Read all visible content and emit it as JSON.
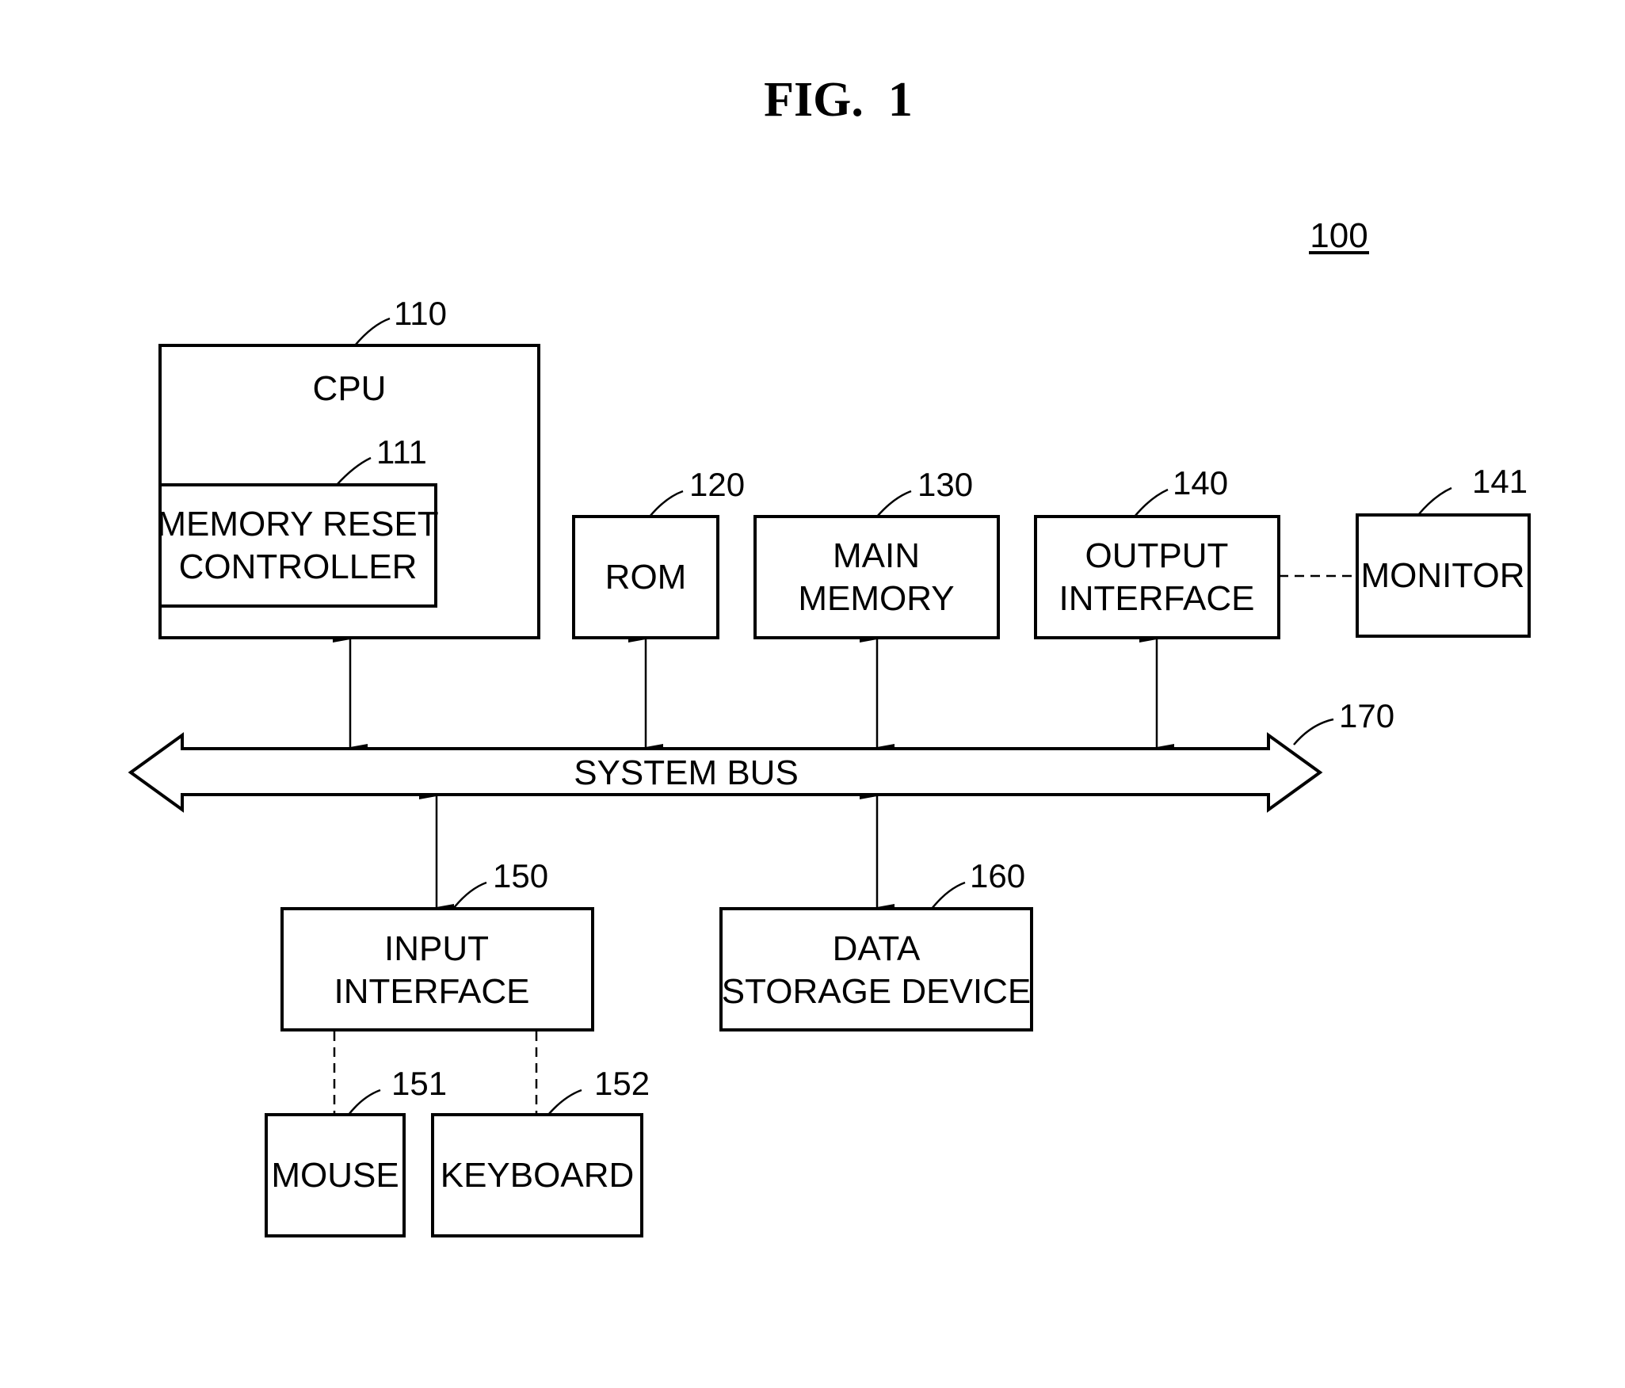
{
  "figure": {
    "title": "FIG.  1",
    "system_ref": "100"
  },
  "blocks": {
    "cpu": {
      "ref": "110",
      "lines": [
        "CPU"
      ]
    },
    "memory_reset_controller": {
      "ref": "111",
      "lines": [
        "MEMORY RESET",
        "CONTROLLER"
      ]
    },
    "rom": {
      "ref": "120",
      "lines": [
        "ROM"
      ]
    },
    "main_memory": {
      "ref": "130",
      "lines": [
        "MAIN",
        "MEMORY"
      ]
    },
    "output_interface": {
      "ref": "140",
      "lines": [
        "OUTPUT",
        "INTERFACE"
      ]
    },
    "monitor": {
      "ref": "141",
      "lines": [
        "MONITOR"
      ]
    },
    "input_interface": {
      "ref": "150",
      "lines": [
        "INPUT",
        "INTERFACE"
      ]
    },
    "mouse": {
      "ref": "151",
      "lines": [
        "MOUSE"
      ]
    },
    "keyboard": {
      "ref": "152",
      "lines": [
        "KEYBOARD"
      ]
    },
    "data_storage": {
      "ref": "160",
      "lines": [
        "DATA",
        "STORAGE DEVICE"
      ]
    },
    "system_bus": {
      "ref": "170",
      "lines": [
        "SYSTEM BUS"
      ]
    }
  },
  "connections": [
    {
      "from": "cpu",
      "to": "system_bus",
      "style": "bidirectional-arrow"
    },
    {
      "from": "rom",
      "to": "system_bus",
      "style": "bidirectional-arrow"
    },
    {
      "from": "main_memory",
      "to": "system_bus",
      "style": "bidirectional-arrow"
    },
    {
      "from": "output_interface",
      "to": "system_bus",
      "style": "bidirectional-arrow"
    },
    {
      "from": "system_bus",
      "to": "input_interface",
      "style": "bidirectional-arrow"
    },
    {
      "from": "system_bus",
      "to": "data_storage",
      "style": "bidirectional-arrow"
    },
    {
      "from": "output_interface",
      "to": "monitor",
      "style": "dashed"
    },
    {
      "from": "input_interface",
      "to": "mouse",
      "style": "dashed"
    },
    {
      "from": "input_interface",
      "to": "keyboard",
      "style": "dashed"
    }
  ]
}
